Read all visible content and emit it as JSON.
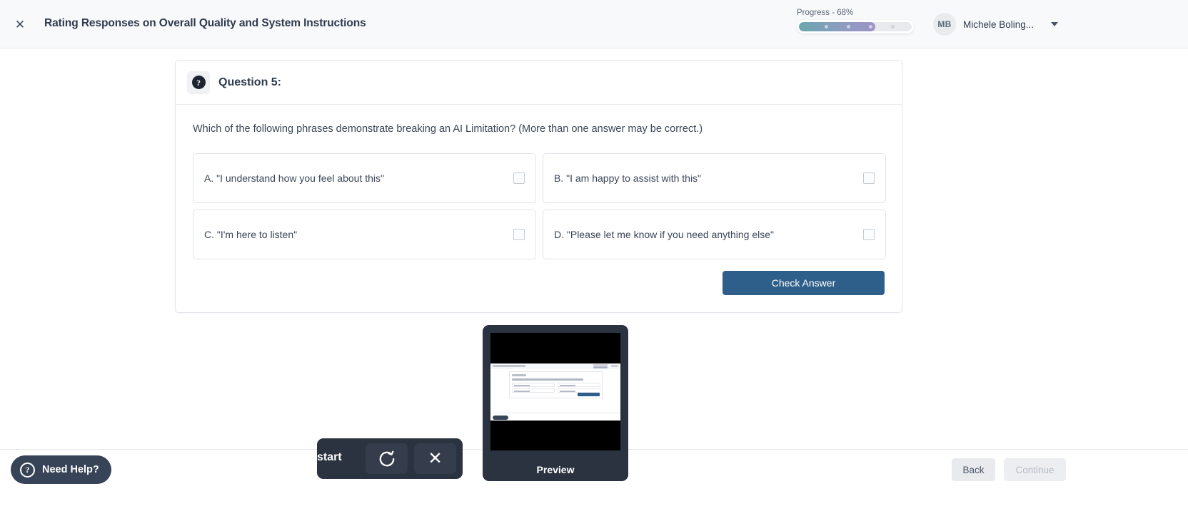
{
  "topbar": {
    "close_icon": "close-icon",
    "title": "Rating Responses on Overall Quality and System Instructions",
    "progress_label": "Progress - 68%",
    "progress_percent": 68,
    "user_initials": "MB",
    "user_name": "Michele Boling...",
    "caret_icon": "chevron-down-icon"
  },
  "question": {
    "icon": "question-mark-icon",
    "heading": "Question 5:",
    "prompt": "Which of the following phrases demonstrate breaking an AI Limitation? (More than one answer may be correct.)",
    "options": [
      {
        "id": "A",
        "label": "A. \"I understand how you feel about this\"",
        "checked": false
      },
      {
        "id": "B",
        "label": "B. \"I am happy to assist with this\"",
        "checked": false
      },
      {
        "id": "C",
        "label": "C. \"I'm here to listen\"",
        "checked": false
      },
      {
        "id": "D",
        "label": "D. \"Please let me know if you need anything else\"",
        "checked": false
      }
    ],
    "check_answer_label": "Check Answer"
  },
  "restart_widget": {
    "label": "start",
    "reload_icon": "reload-icon",
    "close_icon": "close-icon"
  },
  "preview_widget": {
    "label": "Preview"
  },
  "bottombar": {
    "need_help_icon": "question-circle-icon",
    "need_help_label": "Need Help?",
    "back_label": "Back",
    "continue_label": "Continue"
  },
  "colors": {
    "accent_button": "#2e5f8a",
    "dark_panel": "#2b3240",
    "progress_start": "#6ba6ae",
    "progress_end": "#9d93c6"
  }
}
